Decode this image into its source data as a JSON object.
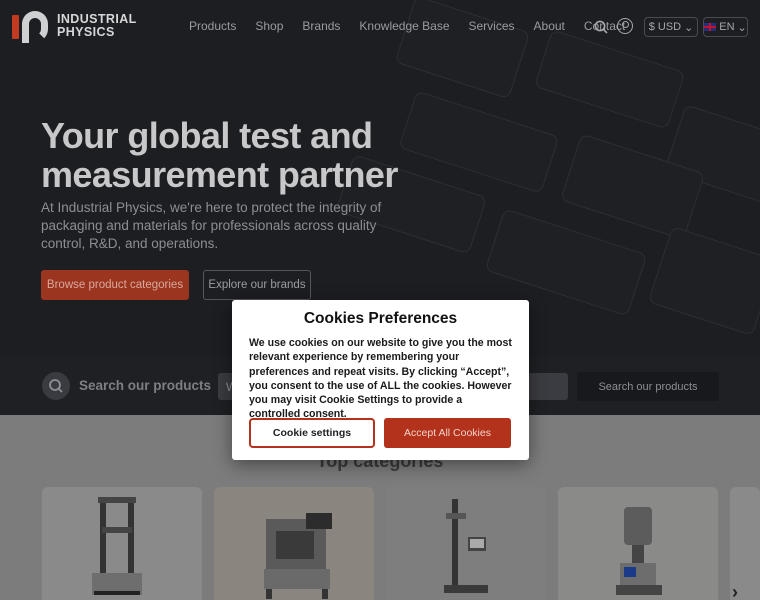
{
  "brand": {
    "line1": "INDUSTRIAL",
    "line2": "PHYSICS",
    "color_accent": "#c23a22"
  },
  "nav": {
    "items": [
      {
        "label": "Products"
      },
      {
        "label": "Shop"
      },
      {
        "label": "Brands"
      },
      {
        "label": "Knowledge Base"
      },
      {
        "label": "Services"
      },
      {
        "label": "About"
      },
      {
        "label": "Contact"
      }
    ],
    "currency": "USD",
    "currency_symbol": "$",
    "language": "EN",
    "icons": {
      "search": "search-icon",
      "account": "user-icon",
      "flag": "uk-flag-icon"
    }
  },
  "hero": {
    "title": "Your global test and measurement partner",
    "description": "At Industrial Physics, we're here to protect the integrity of packaging and materials for professionals across quality control, R&D, and operations.",
    "primary_button": "Browse product categories",
    "secondary_button": "Explore our brands"
  },
  "search": {
    "label": "Search our products",
    "input_value": "W",
    "button": "Search our products"
  },
  "categories": {
    "title": "Top categories",
    "next_arrow": "›"
  },
  "cookie_modal": {
    "title": "Cookies Preferences",
    "body": "We use cookies on our website to give you the most relevant experience by remembering your preferences and repeat visits. By clicking “Accept”, you consent to the use of ALL the cookies. However you may visit Cookie Settings to provide a controlled consent.",
    "settings_button": "Cookie settings",
    "accept_button": "Accept All Cookies",
    "accent_color": "#b3321c"
  }
}
